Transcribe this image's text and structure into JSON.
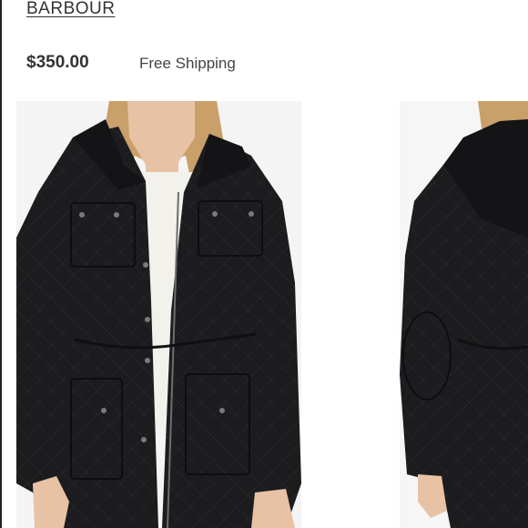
{
  "product": {
    "brand": "BARBOUR",
    "price": "$350.00",
    "shipping": "Free Shipping"
  },
  "gallery": {
    "images": [
      {
        "icon": "jacket-front-photo"
      },
      {
        "icon": "jacket-side-photo"
      }
    ]
  },
  "colors": {
    "jacket": "#1c1c1e",
    "hair": "#c9a06a",
    "skin": "#e8c2a4",
    "sweater": "#f3f1ec"
  }
}
